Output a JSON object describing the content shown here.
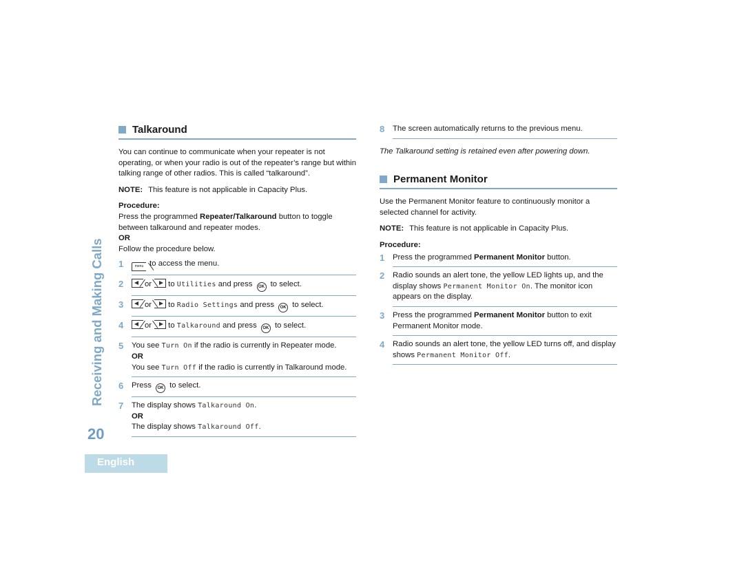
{
  "sidebar": {
    "chapter_title": "Receiving and Making Calls",
    "page_number": "20",
    "language_tab": "English"
  },
  "colors": {
    "accent": "#7fa9c8",
    "page_number": "#6e9cc2",
    "language_tab_bg": "#bcdbe6"
  },
  "talkaround": {
    "heading": "Talkaround",
    "intro": "You can continue to communicate when your repeater is not operating, or when your radio is out of the repeater’s range but within talking range of other radios. This is called “talkaround”.",
    "note_label": "NOTE:",
    "note_text": "This feature is not applicable in Capacity Plus.",
    "procedure_label": "Procedure:",
    "procedure_pre": "Press the programmed ",
    "procedure_button": "Repeater/Talkaround",
    "procedure_post": " button to toggle between talkaround and repeater modes.",
    "or_label": "OR",
    "follow_text": "Follow the procedure below.",
    "steps": [
      {
        "num": "1",
        "icon": "menu-key-icon",
        "text": " to access the menu."
      },
      {
        "num": "2",
        "or": "or",
        "to": " to ",
        "mono": "Utilities",
        "press": " and press ",
        "select": " to select."
      },
      {
        "num": "3",
        "or": "or",
        "to": " to ",
        "mono": "Radio Settings",
        "press": " and press ",
        "select": " to select."
      },
      {
        "num": "4",
        "or": "or",
        "to": " to ",
        "mono": "Talkaround",
        "press": " and press ",
        "select": " to select."
      },
      {
        "num": "5",
        "a_pre": "You see ",
        "a_mono": "Turn On",
        "a_post": " if the radio is currently in Repeater mode.",
        "or": "OR",
        "b_pre": "You see ",
        "b_mono": "Turn Off",
        "b_post": " if the radio is currently in Talkaround mode."
      },
      {
        "num": "6",
        "pre": "Press ",
        "post": " to select."
      },
      {
        "num": "7",
        "a_pre": "The display shows ",
        "a_mono": "Talkaround On",
        "a_post": ".",
        "or": "OR",
        "b_pre": "The display shows ",
        "b_mono": "Talkaround Off",
        "b_post": "."
      },
      {
        "num": "8",
        "text": "The screen automatically returns to the previous menu."
      }
    ],
    "retained_note": "The Talkaround setting is retained even after powering down."
  },
  "permanent_monitor": {
    "heading": "Permanent Monitor",
    "intro": "Use the Permanent Monitor feature to continuously monitor a selected channel for activity.",
    "note_label": "NOTE:",
    "note_text": "This feature is not applicable in Capacity Plus.",
    "procedure_label": "Procedure:",
    "steps": [
      {
        "num": "1",
        "pre": "Press the programmed ",
        "bold": "Permanent Monitor",
        "post": " button."
      },
      {
        "num": "2",
        "pre": "Radio sounds an alert tone, the yellow LED lights up, and the display shows ",
        "mono": "Permanent Monitor On",
        "post": ". The monitor icon appears on the display."
      },
      {
        "num": "3",
        "pre": "Press the programmed ",
        "bold": "Permanent Monitor",
        "post": " button to exit Permanent Monitor mode."
      },
      {
        "num": "4",
        "pre": "Radio sounds an alert tone, the yellow LED turns off, and display shows ",
        "mono": "Permanent Monitor Off",
        "post": "."
      }
    ]
  },
  "icons": {
    "menu": "menu-key-icon",
    "left": "left-navigation-key-icon",
    "right": "right-navigation-key-icon",
    "ok": "ok-key-icon",
    "ok_label": "OK",
    "menu_label": "menu"
  }
}
